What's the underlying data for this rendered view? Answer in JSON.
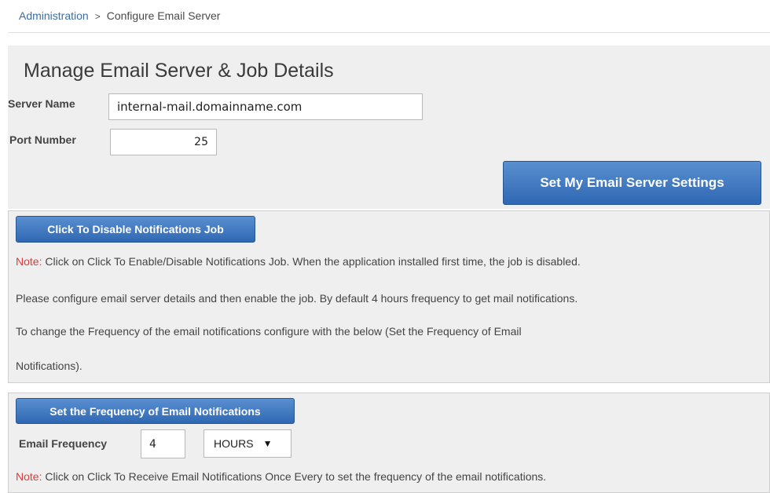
{
  "breadcrumb": {
    "root": "Administration",
    "separator": ">",
    "current": "Configure Email Server"
  },
  "server_section": {
    "title": "Manage Email Server & Job Details",
    "server_name_label": "Server Name",
    "server_name_value": "internal-mail.domainname.com",
    "port_label": "Port Number",
    "port_value": "25",
    "set_settings_button": "Set My Email Server Settings"
  },
  "notifications_section": {
    "toggle_button": "Click To Disable Notifications Job",
    "note_prefix": "Note:",
    "line1": " Click on Click To Enable/Disable Notifications Job. When the application installed first time, the job is disabled.",
    "line2": "Please configure email server details and then enable the job. By default 4 hours frequency to get mail notifications.",
    "line3": "To change the Frequency of the email notifications configure with the below (Set the Frequency of Email",
    "line4": "Notifications)."
  },
  "frequency_section": {
    "set_frequency_button": "Set the Frequency of Email Notifications",
    "frequency_label": "Email Frequency",
    "frequency_value": "4",
    "unit_selected": "HOURS",
    "note_prefix": "Note:",
    "note_text": " Click on Click To Receive Email Notifications Once Every to set the frequency of the email notifications."
  },
  "colors": {
    "button_blue": "#2f68b3",
    "note_red": "#e03a3a",
    "panel_bg": "#efefef"
  },
  "icons": {
    "breadcrumb_separator": "chevron-right-icon",
    "select_arrow": "caret-down-icon"
  }
}
